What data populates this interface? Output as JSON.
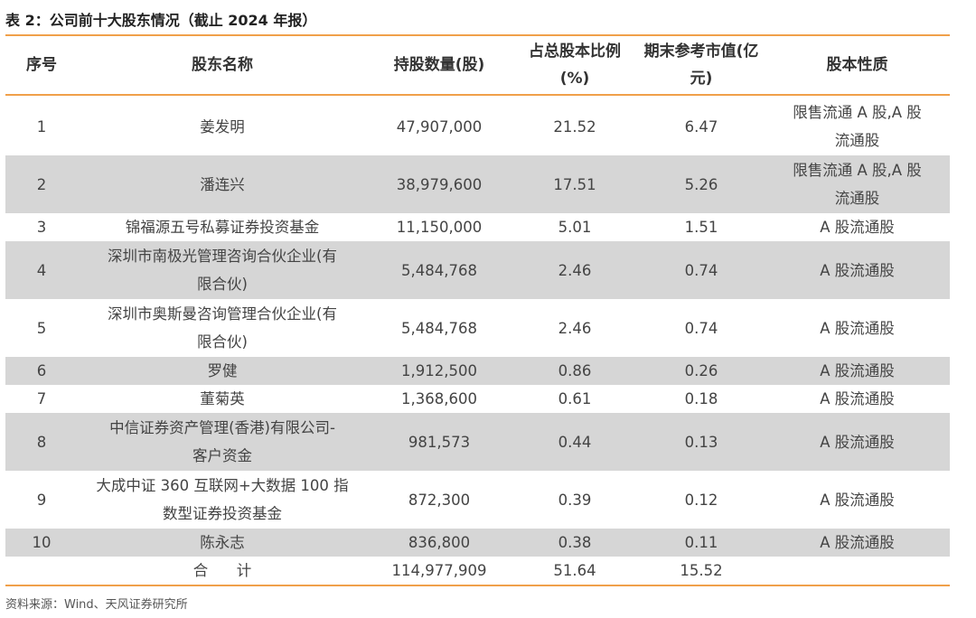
{
  "title": "表 2：公司前十大股东情况（截止 2024 年报）",
  "headers": {
    "seq": "序号",
    "name": "股东名称",
    "shares": "持股数量(股)",
    "ratio": [
      "占总股本比例",
      "(%)"
    ],
    "value": [
      "期末参考市值(亿",
      "元)"
    ],
    "nature": "股本性质"
  },
  "rows": [
    {
      "seq": "1",
      "name": [
        "姜发明"
      ],
      "shares": "47,907,000",
      "ratio": "21.52",
      "value": "6.47",
      "nature": [
        "限售流通 A 股,A 股",
        "流通股"
      ]
    },
    {
      "seq": "2",
      "name": [
        "潘连兴"
      ],
      "shares": "38,979,600",
      "ratio": "17.51",
      "value": "5.26",
      "nature": [
        "限售流通 A 股,A 股",
        "流通股"
      ]
    },
    {
      "seq": "3",
      "name": [
        "锦福源五号私募证券投资基金"
      ],
      "shares": "11,150,000",
      "ratio": "5.01",
      "value": "1.51",
      "nature": [
        "A 股流通股"
      ]
    },
    {
      "seq": "4",
      "name": [
        "深圳市南极光管理咨询合伙企业(有",
        "限合伙)"
      ],
      "shares": "5,484,768",
      "ratio": "2.46",
      "value": "0.74",
      "nature": [
        "A 股流通股"
      ]
    },
    {
      "seq": "5",
      "name": [
        "深圳市奥斯曼咨询管理合伙企业(有",
        "限合伙)"
      ],
      "shares": "5,484,768",
      "ratio": "2.46",
      "value": "0.74",
      "nature": [
        "A 股流通股"
      ]
    },
    {
      "seq": "6",
      "name": [
        "罗健"
      ],
      "shares": "1,912,500",
      "ratio": "0.86",
      "value": "0.26",
      "nature": [
        "A 股流通股"
      ]
    },
    {
      "seq": "7",
      "name": [
        "董菊英"
      ],
      "shares": "1,368,600",
      "ratio": "0.61",
      "value": "0.18",
      "nature": [
        "A 股流通股"
      ]
    },
    {
      "seq": "8",
      "name": [
        "中信证券资产管理(香港)有限公司-",
        "客户资金"
      ],
      "shares": "981,573",
      "ratio": "0.44",
      "value": "0.13",
      "nature": [
        "A 股流通股"
      ]
    },
    {
      "seq": "9",
      "name": [
        "大成中证 360 互联网+大数据 100 指",
        "数型证券投资基金"
      ],
      "shares": "872,300",
      "ratio": "0.39",
      "value": "0.12",
      "nature": [
        "A 股流通股"
      ]
    },
    {
      "seq": "10",
      "name": [
        "陈永志"
      ],
      "shares": "836,800",
      "ratio": "0.38",
      "value": "0.11",
      "nature": [
        "A 股流通股"
      ]
    }
  ],
  "total": {
    "label": "合      计",
    "shares": "114,977,909",
    "ratio": "51.64",
    "value": "15.52"
  },
  "source": "资料来源：Wind、天风证券研究所",
  "colors": {
    "accent": "#f0a04a",
    "shade": "#d6d6d6"
  }
}
